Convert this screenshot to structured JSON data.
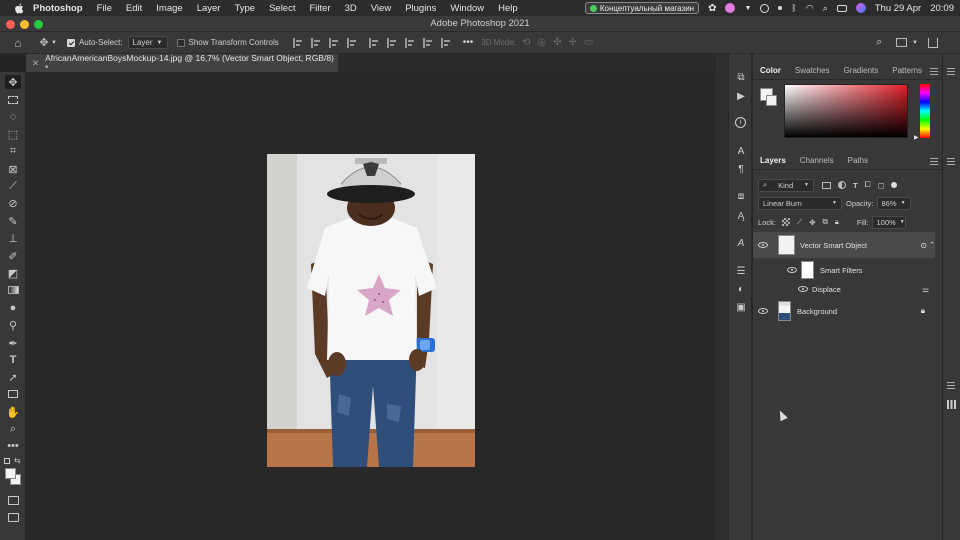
{
  "menubar": {
    "app_name": "Photoshop",
    "items": [
      "File",
      "Edit",
      "Image",
      "Layer",
      "Type",
      "Select",
      "Filter",
      "3D",
      "View",
      "Plugins",
      "Window",
      "Help"
    ],
    "store_pill": "Концептуальный магазин",
    "date": "Thu 29 Apr",
    "time": "20:09"
  },
  "window": {
    "title": "Adobe Photoshop 2021",
    "traffic_colors": [
      "#ff5f57",
      "#febc2e",
      "#28c840"
    ]
  },
  "options_bar": {
    "auto_select_label": "Auto-Select:",
    "auto_select_checked": true,
    "auto_select_value": "Layer",
    "show_transform_label": "Show Transform Controls",
    "show_transform_checked": false,
    "mode_3d_label": "3D Mode:"
  },
  "document": {
    "tab_title": "AfricanAmericanBoysMockup-14.jpg @ 16,7% (Vector Smart Object, RGB/8) *"
  },
  "color_panel": {
    "tabs": [
      "Color",
      "Swatches",
      "Gradients",
      "Patterns"
    ],
    "active_tab": "Color",
    "picker_hue_color": "#e01f2a"
  },
  "layers_panel": {
    "tabs": [
      "Layers",
      "Channels",
      "Paths"
    ],
    "active_tab": "Layers",
    "kind_label": "Kind",
    "blend_mode": "Linear Burn",
    "opacity_label": "Opacity:",
    "opacity_value": "86%",
    "lock_label": "Lock:",
    "fill_label": "Fill:",
    "fill_value": "100%",
    "layers": [
      {
        "name": "Vector Smart Object",
        "selected": true
      },
      {
        "name": "Smart Filters",
        "selected": false
      },
      {
        "name": "Displace",
        "selected": false
      },
      {
        "name": "Background",
        "selected": false
      }
    ]
  },
  "colors": {
    "accent_star": "#d9a6c8",
    "cap": "#1e1e1e",
    "jeans": "#2f4e7a",
    "watch": "#2a6fd1",
    "floor": "#b87548"
  }
}
